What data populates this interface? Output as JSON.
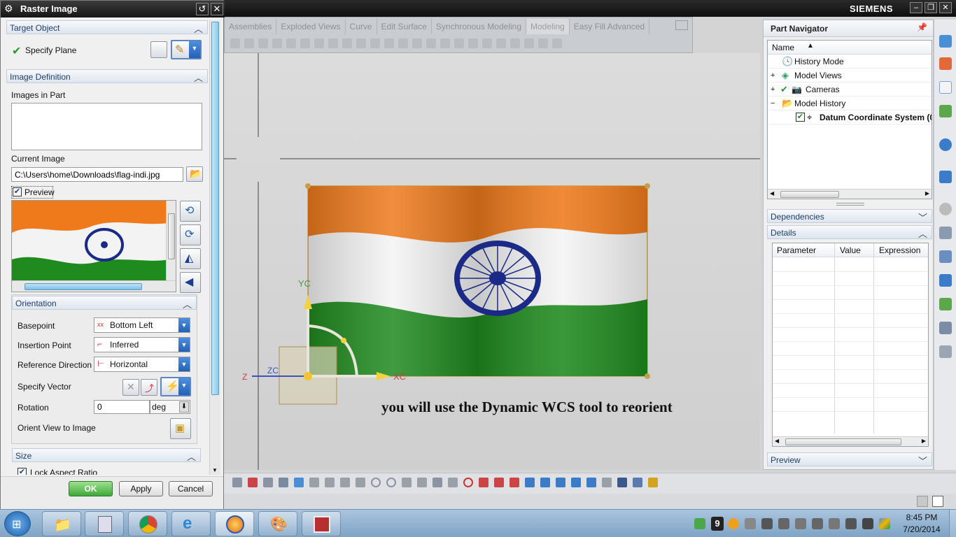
{
  "app": {
    "brand": "SIEMENS",
    "window_buttons": [
      "–",
      "❐",
      "✕"
    ]
  },
  "ribbon": {
    "tabs": [
      "Assemblies",
      "Exploded Views",
      "Curve",
      "Edit Surface",
      "Synchronous Modeling",
      "Modeling",
      "Easy Fill Advanced"
    ],
    "active_tab": "Modeling"
  },
  "dialog": {
    "title": "Raster Image",
    "target_object": {
      "header": "Target Object",
      "specify_plane": "Specify Plane"
    },
    "image_definition": {
      "header": "Image Definition",
      "images_in_part": "Images in Part",
      "current_image_label": "Current Image",
      "current_image_value": "C:\\Users\\home\\Downloads\\flag-indi.jpg",
      "preview_label": "Preview",
      "preview_checked": true
    },
    "orientation": {
      "header": "Orientation",
      "basepoint_label": "Basepoint",
      "basepoint_value": "Bottom Left",
      "basepoint_icon_text": "xx",
      "insertion_label": "Insertion Point",
      "insertion_value": "Inferred",
      "refdir_label": "Reference Direction",
      "refdir_value": "Horizontal",
      "vector_label": "Specify Vector",
      "rotation_label": "Rotation",
      "rotation_value": "0",
      "rotation_unit": "deg",
      "orient_label": "Orient View to Image"
    },
    "size": {
      "header": "Size",
      "lock_aspect": "Lock Aspect Ratio"
    },
    "buttons": {
      "ok": "OK",
      "apply": "Apply",
      "cancel": "Cancel"
    }
  },
  "graphics": {
    "axis_labels": {
      "yc": "YC",
      "zc": "ZC",
      "xc": "XC",
      "z": "Z"
    },
    "caption": "you will use the Dynamic WCS tool to reorient"
  },
  "navigator": {
    "title": "Part Navigator",
    "column": "Name",
    "items": [
      {
        "label": "History Mode",
        "expander": ""
      },
      {
        "label": "Model Views",
        "expander": "+"
      },
      {
        "label": "Cameras",
        "expander": "+"
      },
      {
        "label": "Model History",
        "expander": "−"
      },
      {
        "label": "Datum Coordinate System (0",
        "expander": ""
      }
    ],
    "dependencies": "Dependencies",
    "details": "Details",
    "detail_columns": [
      "Parameter",
      "Value",
      "Expression"
    ],
    "preview": "Preview"
  },
  "taskbar": {
    "time": "8:45 PM",
    "date": "7/20/2014",
    "badge": "9"
  },
  "colors": {
    "saffron": "#ef7b1c",
    "green": "#1f8a1e",
    "chakra": "#1a2a86",
    "accent_blue": "#2461b6",
    "ok_green": "#3fa83a"
  }
}
